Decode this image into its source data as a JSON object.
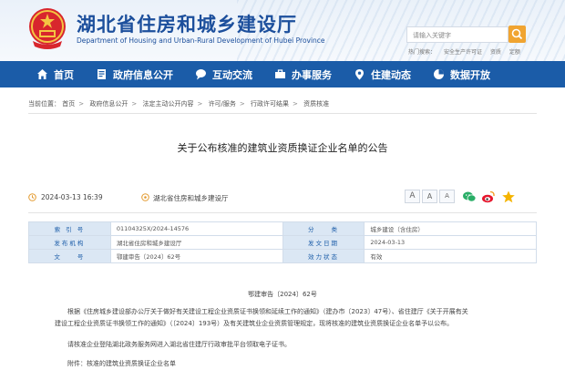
{
  "header": {
    "title": "湖北省住房和城乡建设厅",
    "subtitle": "Department of Housing and Urban-Rural Development of Hubei Province",
    "search_placeholder": "请输入关键字",
    "hot_words": [
      "热门搜索：",
      "安全生产许可证",
      "资质",
      "定额"
    ]
  },
  "nav": {
    "items": [
      {
        "label": "首页",
        "icon": "home-icon"
      },
      {
        "label": "政府信息公开",
        "icon": "document-icon"
      },
      {
        "label": "互动交流",
        "icon": "chat-icon"
      },
      {
        "label": "办事服务",
        "icon": "service-icon"
      },
      {
        "label": "住建动态",
        "icon": "location-icon"
      },
      {
        "label": "数据开放",
        "icon": "chart-icon"
      }
    ]
  },
  "breadcrumb": {
    "prefix": "当前位置：",
    "items": [
      "首页",
      "政府信息公开",
      "法定主动公开内容",
      "许可/服务",
      "行政许可结果",
      "资质核准"
    ]
  },
  "article": {
    "title": "关于公布核准的建筑业资质换证企业名单的公告",
    "date": "2024-03-13 16:39",
    "source": "湖北省住房和城乡建设厅",
    "font_large": "A",
    "font_medium": "A",
    "font_small": "A"
  },
  "info_table": {
    "rows": [
      {
        "k1": "索 引 号",
        "v1": "01104325X/2024-14576",
        "k2": "分　　类",
        "v2": "城乡建设（含住房）"
      },
      {
        "k1": "发布机构",
        "v1": "湖北省住房和城乡建设厅",
        "k2": "发文日期",
        "v2": "2024-03-13"
      },
      {
        "k1": "文　　号",
        "v1": "鄂建审告〔2024〕62号",
        "k2": "效力状态",
        "v2": "有效"
      }
    ]
  },
  "body": {
    "doc_no": "鄂建审告〔2024〕62号",
    "para1_line1": "根据《住房城乡建设部办公厅关于做好有关建设工程企业资质证书换领和延续工作的通知》（建办市〔2023〕47号）、省住建厅《关于开展有关",
    "para1_line2": "建设工程企业资质证书换领工作的通知》（〔2024〕193号）及有关建筑业企业资质管理规定，现将核准的建筑业资质换证企业名单予以公布。",
    "para2": "请核准企业登陆湖北政务服务网进入湖北省住建厅行政审批平台领取电子证书。",
    "para3": "附件：核准的建筑业资质换证企业名单"
  },
  "colors": {
    "nav_bg": "#1b5ca8",
    "brand_text": "#1c4f9c",
    "search_button": "#f0a431",
    "table_key_bg": "#dbe7f4"
  }
}
